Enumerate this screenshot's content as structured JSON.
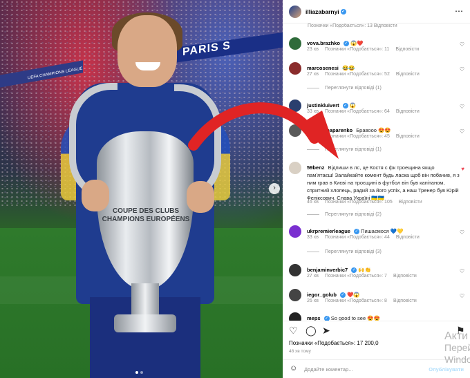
{
  "post": {
    "author": "illiazabarnyi",
    "header_more": "⋯",
    "photo_alt_banner": "PARIS S",
    "trophy_text": "COUPE DES CLUBS CHAMPIONS EUROPÉENS",
    "ucl_board": "UEFA CHAMPIONS LEAGUE"
  },
  "top_meta": "Позначки «Подобається»: 13   Відповісти",
  "comments": [
    {
      "user": "vova.brazhko",
      "verified": true,
      "text": "😱❤️",
      "time": "23 хв",
      "likes": "Позначки «Подобається»: 11",
      "reply": "Відповісти",
      "liked": false,
      "avatar_color": "#2f6b3a"
    },
    {
      "user": "marcosenesi",
      "verified": false,
      "text": "😂😂",
      "time": "27 хв",
      "likes": "Позначки «Подобається»: 52",
      "reply": "Відповісти",
      "liked": false,
      "avatar_color": "#8a2c2c"
    },
    {
      "user": "justinkluivert",
      "verified": true,
      "text": "😱",
      "time": "33 хв",
      "likes": "Позначки «Подобається»: 64",
      "reply": "Відповісти",
      "liked": false,
      "avatar_color": "#2b3f6e"
    },
    {
      "user": "andriy.shaparenko",
      "verified": false,
      "text": "Бравооо 😍😍",
      "time": "33 хв",
      "likes": "Позначки «Подобається»: 45",
      "reply": "Відповісти",
      "liked": false,
      "avatar_color": "#5a5a5a"
    },
    {
      "user": "59benz",
      "verified": false,
      "text": "Відпиши в лс, це Костя с фк троещина якщо памʼятаєш! Залайкайте комент будь ласка щоб він побачив, я з ним грав в Києві на троєщині в футбол він був капітаном, спритний хлопець, радий за його успіх, а наш Тренер був Юрій Феліксович. Слава Україні 🇺🇦🇺🇦",
      "time": "46 хв",
      "likes": "Позначки «Подобається»: 105",
      "reply": "Відповісти",
      "liked": true,
      "avatar_color": "#d9d0c4"
    },
    {
      "user": "ukrpremierleague",
      "verified": true,
      "text": "Пишаємося 💙💛",
      "time": "33 хв",
      "likes": "Позначки «Подобається»: 44",
      "reply": "Відповісти",
      "liked": false,
      "avatar_color": "#7a2fd0"
    },
    {
      "user": "benjaminverbic7",
      "verified": true,
      "text": "🙌👏",
      "time": "27 хв",
      "likes": "Позначки «Подобається»: 7",
      "reply": "Відповісти",
      "liked": false,
      "avatar_color": "#333333"
    },
    {
      "user": "iegor_golub",
      "verified": true,
      "text": "❤️😱",
      "time": "26 хв",
      "likes": "Позначки «Подобається»: 8",
      "reply": "Відповісти",
      "liked": false,
      "avatar_color": "#444444"
    },
    {
      "user": "meps",
      "verified": true,
      "text": "So good to see 😍😍",
      "time": "",
      "likes": "",
      "reply": "",
      "liked": false,
      "avatar_color": "#222222"
    }
  ],
  "replies": [
    "Переглянути відповіді (1)",
    "Переглянути відповіді (1)",
    "Переглянути відповіді (2)",
    "Переглянути відповіді (3)"
  ],
  "footer": {
    "likes": "Позначки «Подобається»: 17 200,0",
    "time": "48 хв тому",
    "comment_placeholder": "Додайте коментар...",
    "post_label": "Опублікувати"
  },
  "icons": {
    "heart": "♡",
    "comment": "◯",
    "share": "➤",
    "bookmark": "⚑",
    "emoji": "☺",
    "next": "›"
  },
  "windows_watermark": [
    "Акти",
    "Перейд",
    "Windo"
  ],
  "colors": {
    "arrow": "#e02424",
    "link": "#3897f0",
    "liked": "#ed4956"
  }
}
